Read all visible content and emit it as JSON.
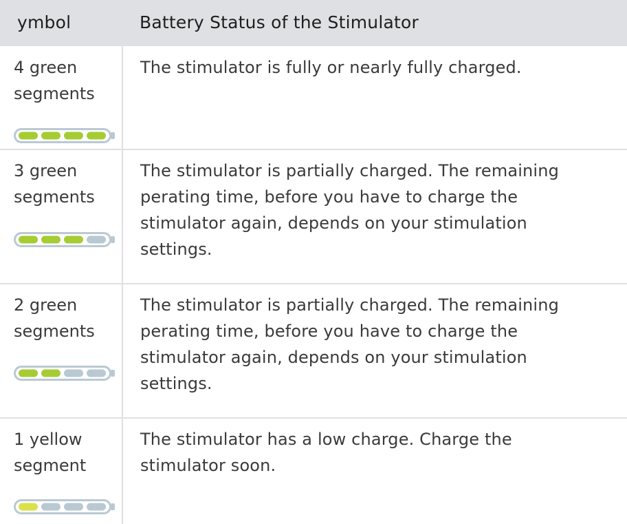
{
  "header": {
    "symbol_label": "ymbol",
    "status_label": "Battery Status of the Stimulator"
  },
  "rows": [
    {
      "symbol_label": "4 green\nsegments",
      "description": "The stimulator is fully or nearly fully charged.",
      "segments": [
        "green",
        "green",
        "green",
        "green"
      ]
    },
    {
      "symbol_label": "3 green\nsegments",
      "description": "The stimulator is partially charged. The remaining\n perating time, before you have to charge the\nstimulator again, depends on your stimulation\nsettings.",
      "segments": [
        "green",
        "green",
        "green",
        "empty"
      ]
    },
    {
      "symbol_label": "2 green\nsegments",
      "description": "The stimulator is partially charged. The remaining\n perating time, before you have to charge the\nstimulator again, depends on your stimulation\nsettings.",
      "segments": [
        "green",
        "green",
        "empty",
        "empty"
      ]
    },
    {
      "symbol_label": "1 yellow\nsegment",
      "description": "The stimulator has a low charge. Charge the\nstimulator soon.",
      "segments": [
        "yellow",
        "empty",
        "empty",
        "empty"
      ]
    }
  ],
  "colors": {
    "header_bg": "#dee0e3",
    "divider": "#dee0e3",
    "text": "#3a3a3a",
    "battery_outline": "#b9c9d3",
    "segment_green": "#a6cc33",
    "segment_yellow": "#d9e24a",
    "segment_empty": "#b9c9d3"
  }
}
